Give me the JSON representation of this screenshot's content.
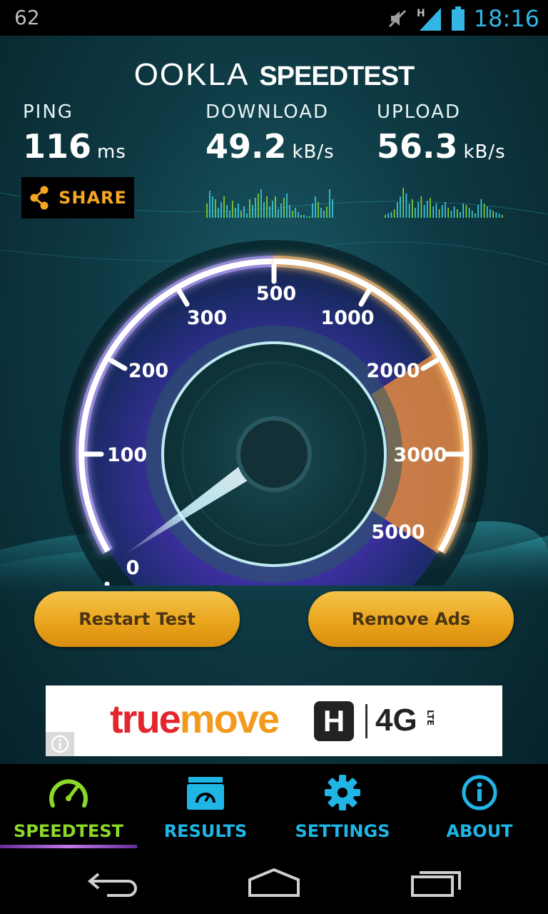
{
  "status_bar": {
    "notification": "62",
    "network": "H",
    "time": "18:16"
  },
  "app": {
    "logo_ookla": "OOKLA",
    "logo_speedtest": "SPEEDTEST"
  },
  "results": {
    "ping": {
      "label": "PING",
      "value": "116",
      "unit": "ms"
    },
    "download": {
      "label": "DOWNLOAD",
      "value": "49.2",
      "unit": "kB/s"
    },
    "upload": {
      "label": "UPLOAD",
      "value": "56.3",
      "unit": "kB/s"
    }
  },
  "share": {
    "label": "SHARE",
    "icon": "share-icon"
  },
  "gauge": {
    "ticks": [
      "0",
      "100",
      "200",
      "300",
      "500",
      "1000",
      "2000",
      "3000",
      "5000"
    ],
    "needle_value_kbs": 49.2
  },
  "buttons": {
    "restart": "Restart Test",
    "remove_ads": "Remove Ads"
  },
  "ad": {
    "brand_true": "true",
    "brand_move": "move",
    "brand_h": "H",
    "brand_4g": "4G",
    "brand_lte": "LTE",
    "info_icon": "info-icon"
  },
  "nav": {
    "items": [
      {
        "label": "SPEEDTEST",
        "icon": "speedometer-icon",
        "active": true
      },
      {
        "label": "RESULTS",
        "icon": "results-folder-icon",
        "active": false
      },
      {
        "label": "SETTINGS",
        "icon": "gear-icon",
        "active": false
      },
      {
        "label": "ABOUT",
        "icon": "info-icon",
        "active": false
      }
    ]
  },
  "colors": {
    "accent_cyan": "#33b5e5",
    "active_green": "#8cd82a",
    "share_orange": "#f5a623",
    "button_gold": "#e9a21a",
    "ad_red": "#e3262d",
    "ad_orange": "#f39a1e"
  }
}
